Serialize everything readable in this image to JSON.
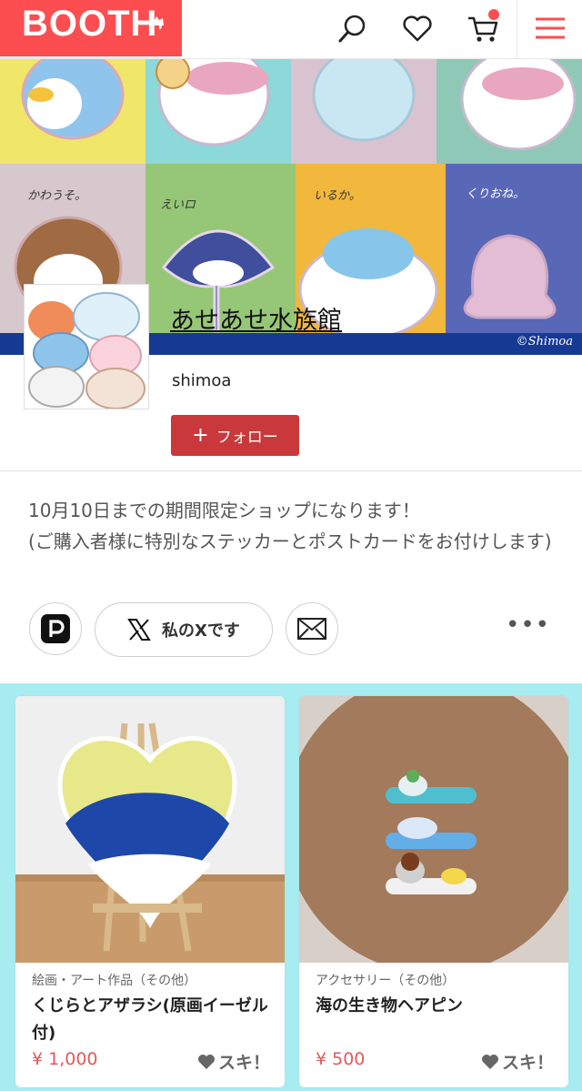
{
  "header": {
    "logo": "BOOTH",
    "icons": [
      "search-icon",
      "heart-icon",
      "cart-icon",
      "menu-icon"
    ]
  },
  "banner": {
    "labels": [
      "かわうそ。",
      "えいロ",
      "いるか。",
      "くりおね。"
    ],
    "credit": "©Shimoa"
  },
  "shop": {
    "title": "あせあせ水族館",
    "owner": "shimoa",
    "follow_label": "フォロー",
    "description_line1": "10月10日までの期間限定ショップになります！",
    "description_line2": "(ご購入者様に特別なステッカーとポストカードをお付けします)"
  },
  "social": {
    "x_label": "私のXです"
  },
  "items": [
    {
      "category": "絵画・アート作品（その他）",
      "name": "くじらとアザラシ(原画イーゼル付)",
      "price": "¥ 1,000",
      "like": "スキ！"
    },
    {
      "category": "アクセサリー（その他）",
      "name": "海の生き物ヘアピン",
      "price": "¥ 500",
      "like": "スキ！"
    }
  ],
  "colors": {
    "brand": "#fc4d50",
    "follow": "#c9393b",
    "items_bg": "#a7ecf1",
    "banner_bar": "#163a94"
  }
}
